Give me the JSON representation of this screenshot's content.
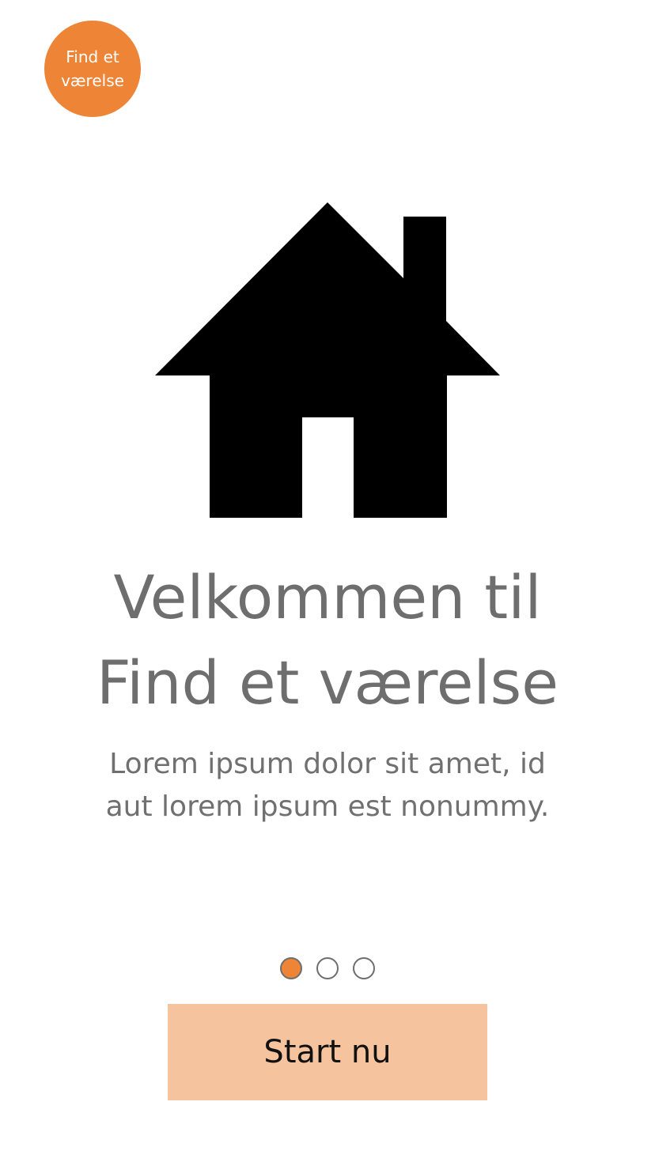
{
  "app": {
    "logo_line1": "Find et",
    "logo_line2": "værelse"
  },
  "hero": {
    "icon": "house-icon",
    "title_line1": "Velkommen til",
    "title_line2": "Find et værelse",
    "body_line1": "Lorem ipsum dolor sit amet, id",
    "body_line2": "aut lorem ipsum est nonummy."
  },
  "pager": {
    "pages": 3,
    "active_index": 0
  },
  "cta": {
    "label": "Start nu"
  },
  "colors": {
    "brand": "#ed8436",
    "button_bg": "#f5c39d",
    "text_muted": "#6e6e6e"
  }
}
